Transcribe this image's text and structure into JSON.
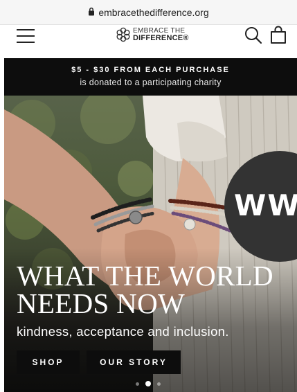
{
  "browser": {
    "url": "embracethedifference.org",
    "icons": {
      "lock": "lock-icon"
    }
  },
  "header": {
    "logo_line1": "EMBRACE THE",
    "logo_line2": "DIFFERENCE®",
    "icons": [
      "hamburger-menu-icon",
      "search-icon",
      "shopping-bag-icon"
    ]
  },
  "promo": {
    "line1": "$5 - $30 FROM EACH PURCHASE",
    "line2": "is donated to a participating charity"
  },
  "hero": {
    "badge_text": "WWV",
    "headline_line1": "WHAT THE WORLD",
    "headline_line2": "NEEDS NOW",
    "subline": "kindness, acceptance and inclusion.",
    "shop_label": "SHOP",
    "story_label": "OUR STORY",
    "slides_total": 3,
    "active_slide": 2
  }
}
